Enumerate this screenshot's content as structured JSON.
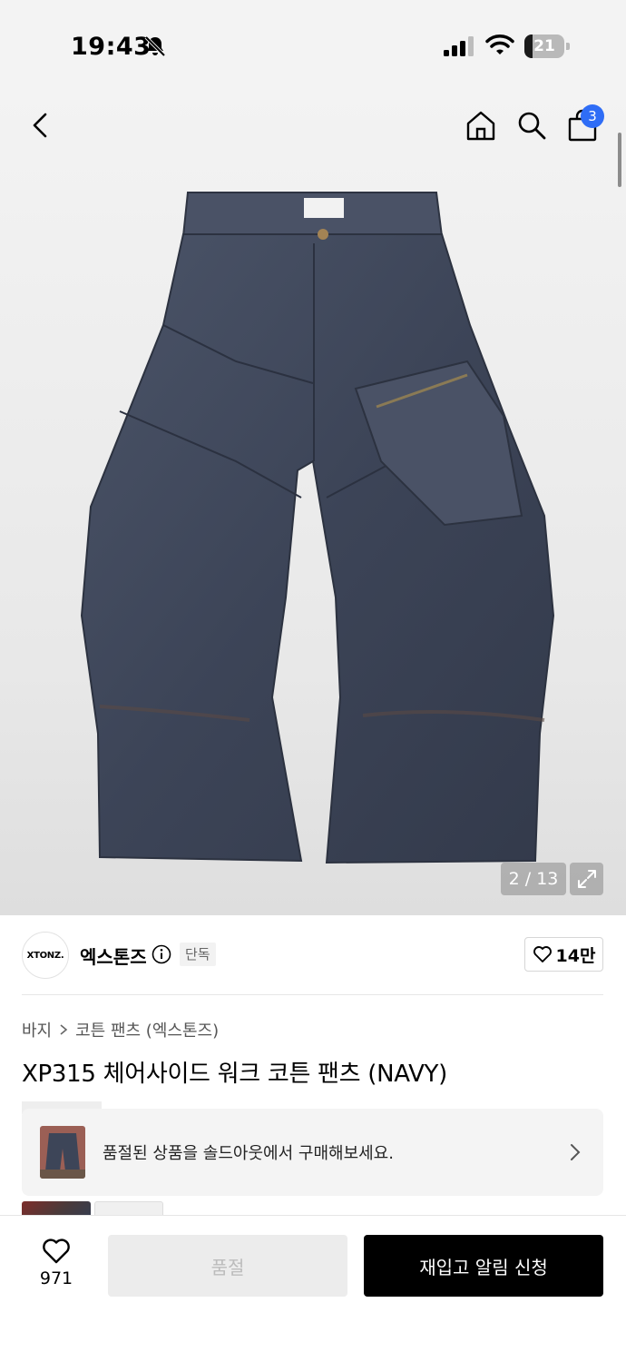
{
  "status_bar": {
    "time": "19:43",
    "battery": "21",
    "battery_level": 0.21
  },
  "header": {
    "cart_count": "3"
  },
  "gallery": {
    "counter": "2 / 13"
  },
  "brand": {
    "logo_text": "XTONZ.",
    "name": "엑스톤즈",
    "badge": "단독",
    "likes": "14만"
  },
  "product": {
    "breadcrumb": [
      "바지",
      "코튼 팬츠 (엑스톤즈)"
    ],
    "title": "XP315 체어사이드 워크 코튼 팬츠 (NAVY)"
  },
  "soldout_banner": {
    "text": "품절된 상품을 솔드아웃에서 구매해보세요."
  },
  "bottom_bar": {
    "wish_count": "971",
    "soldout_label": "품절",
    "restock_label": "재입고 알림 신청"
  },
  "colors": {
    "accent_badge": "#2f6df6",
    "primary_button": "#000000",
    "disabled_button": "#ececec"
  }
}
